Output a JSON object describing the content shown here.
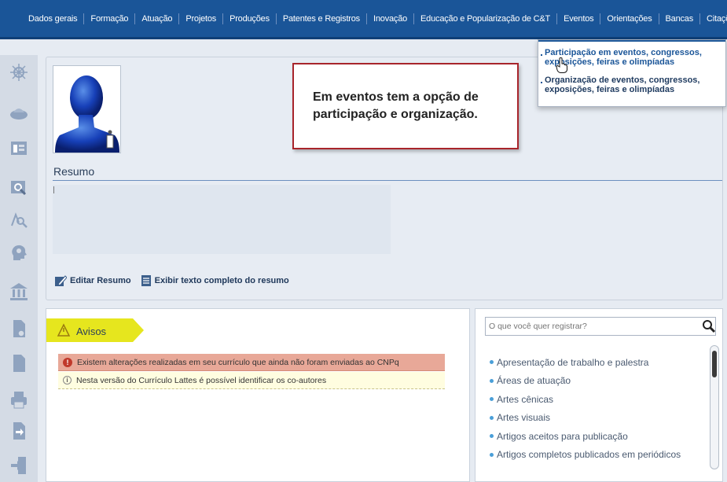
{
  "nav": {
    "items": [
      "Dados gerais",
      "Formação",
      "Atuação",
      "Projetos",
      "Produções",
      "Patentes e Registros",
      "Inovação",
      "Educação e Popularização de C&T",
      "Eventos",
      "Orientações",
      "Bancas",
      "Citações"
    ]
  },
  "dropdown": {
    "item1": "Participação em eventos, congressos, exposições, feiras e olimpíadas",
    "item2": "Organização de eventos, congressos, exposições, feiras e olimpíadas"
  },
  "callout": {
    "text": "Em eventos tem a opção de participação e organização."
  },
  "profile": {
    "summary_title": "Resumo",
    "edit_label": "Editar Resumo",
    "full_text_label": "Exibir texto completo do resumo"
  },
  "avisos": {
    "title": "Avisos",
    "warning": "Existem alterações realizadas em seu currículo que ainda não foram enviadas ao CNPq",
    "info": "Nesta versão do Currículo Lattes é possível identificar os co-autores"
  },
  "registrar": {
    "placeholder": "O que você quer registrar?",
    "items": [
      "Apresentação de trabalho e palestra",
      "Áreas de atuação",
      "Artes cênicas",
      "Artes visuais",
      "Artigos aceitos para publicação",
      "Artigos completos publicados em periódicos"
    ]
  },
  "colors": {
    "nav_bg": "#1a5598",
    "warning_bg": "#e8a898",
    "info_bg": "#fffde0",
    "avisos_tab": "#e6e61e",
    "callout_border": "#a8252b"
  }
}
